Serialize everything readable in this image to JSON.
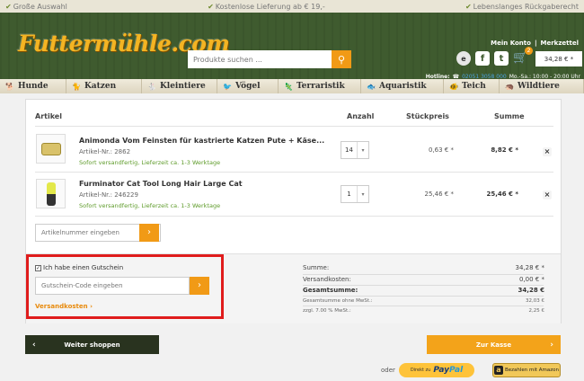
{
  "promo": [
    "Große Auswahl",
    "Kostenlose Lieferung ab € 19,-",
    "Lebenslanges Rückgaberecht"
  ],
  "header": {
    "logo": "Futtermühle.com",
    "search_placeholder": "Produkte suchen ...",
    "account": "Mein Konto",
    "wishlist": "Merkzettel",
    "cart_count": "2",
    "cart_total": "34,28 € *",
    "hotline_label": "Hotline:",
    "hotline_number": "02051 3058 000",
    "hotline_hours": "Mo.-Sa.: 10:00 - 20:00 Uhr"
  },
  "nav": [
    {
      "label": "Hunde",
      "icon": "dog-icon"
    },
    {
      "label": "Katzen",
      "icon": "cat-icon"
    },
    {
      "label": "Kleintiere",
      "icon": "rabbit-icon"
    },
    {
      "label": "Vögel",
      "icon": "bird-icon"
    },
    {
      "label": "Terraristik",
      "icon": "lizard-icon"
    },
    {
      "label": "Aquaristik",
      "icon": "fish-icon"
    },
    {
      "label": "Teich",
      "icon": "koi-icon"
    },
    {
      "label": "Wildtiere",
      "icon": "hedgehog-icon"
    }
  ],
  "cart": {
    "headers": {
      "article": "Artikel",
      "quantity": "Anzahl",
      "unit_price": "Stückpreis",
      "sum": "Summe"
    },
    "items": [
      {
        "name": "Animonda Vom Feinsten für kastrierte Katzen Pute + Käse...",
        "article_no": "Artikel-Nr.: 2862",
        "delivery": "Sofort versandfertig, Lieferzeit ca. 1-3 Werktage",
        "qty": "14",
        "unit_price": "0,63 € *",
        "sum": "8,82 € *"
      },
      {
        "name": "Furminator Cat Tool Long Hair Large Cat",
        "article_no": "Artikel-Nr.: 246229",
        "delivery": "Sofort versandfertig, Lieferzeit ca. 1-3 Werktage",
        "qty": "1",
        "unit_price": "25,46 € *",
        "sum": "25,46 € *"
      }
    ],
    "article_input_placeholder": "Artikelnummer eingeben",
    "voucher_checkbox": "Ich habe einen Gutschein",
    "voucher_placeholder": "Gutschein-Code eingeben",
    "shipping_link": "Versandkosten ›",
    "totals": [
      {
        "label": "Summe:",
        "value": "34,28 € *"
      },
      {
        "label": "Versandkosten:",
        "value": "0,00 € *"
      },
      {
        "label": "Gesamtsumme:",
        "value": "34,28 €"
      },
      {
        "label": "Gesamtsumme ohne MwSt.:",
        "value": "32,03 €"
      },
      {
        "label": "zzgl. 7.00 % MwSt.:",
        "value": "2,25 €"
      }
    ]
  },
  "actions": {
    "continue": "Weiter shoppen",
    "checkout": "Zur Kasse",
    "or": "oder",
    "paypal_prefix": "Direkt zu",
    "paypal_a": "Pay",
    "paypal_b": "Pal",
    "amazon": "Bezahlen mit Amazon"
  }
}
